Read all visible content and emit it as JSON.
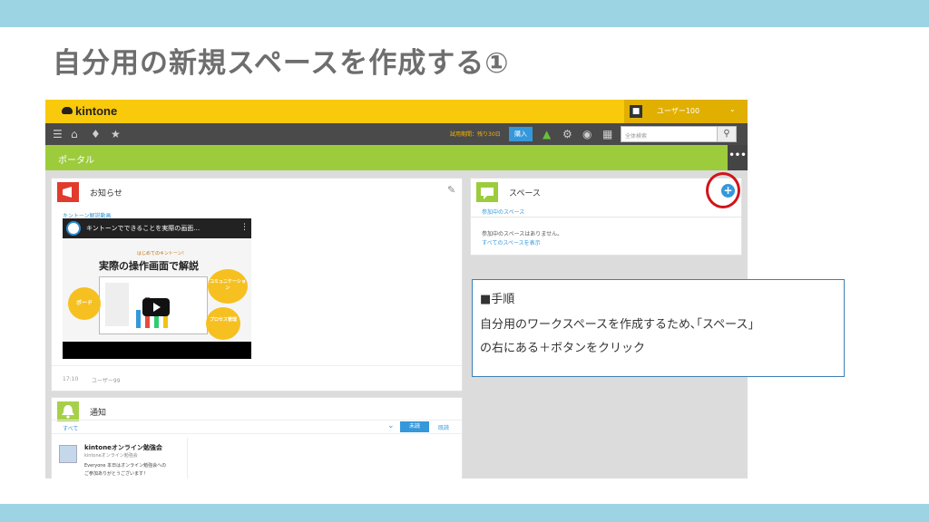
{
  "slide": {
    "title": "自分用の新規スペースを作成する①"
  },
  "kintone": {
    "logo_text": "kintone",
    "user_name": "ユーザー100",
    "trial_text": "試用期間：残り30日",
    "buy_label": "購入",
    "search_placeholder": "全体検索",
    "portal_label": "ポータル",
    "more_label": "•••"
  },
  "notice": {
    "title": "お知らせ",
    "link_text": "キントーン解説動画",
    "video": {
      "title": "キントーンでできることを実際の画面…",
      "subtitle": "はじめてのキントーン！",
      "heading": "実際の操作画面で解説",
      "bubbles": [
        "ボード",
        "コミュニケーション",
        "プロセス管理"
      ]
    },
    "footer_time": "17:10",
    "footer_user": "ユーザー99"
  },
  "space": {
    "title": "スペース",
    "tab_label": "参加中のスペース",
    "empty_text": "参加中のスペースはありません。",
    "show_all_link": "すべてのスペースを表示"
  },
  "notifications": {
    "title": "通知",
    "filter_label": "すべて",
    "unread_button": "未読",
    "read_button": "既読",
    "item": {
      "title": "kintoneオンライン勉強会",
      "sub": "kintoneオンライン勉強会",
      "body1": "Everyone 本日はオンライン勉強会への",
      "body2": "ご参加ありがとうございます！"
    }
  },
  "tooltip": {
    "heading": "■手順",
    "line1": "自分用のワークスペースを作成するため､｢スペース」",
    "line2": "の右にある＋ボタンをクリック"
  },
  "colors": {
    "band": "#9dd4e3",
    "kintone_yellow": "#f9c90b",
    "portal_green": "#9ccc3c",
    "accent_blue": "#3498db",
    "highlight_red": "#d0141a"
  }
}
